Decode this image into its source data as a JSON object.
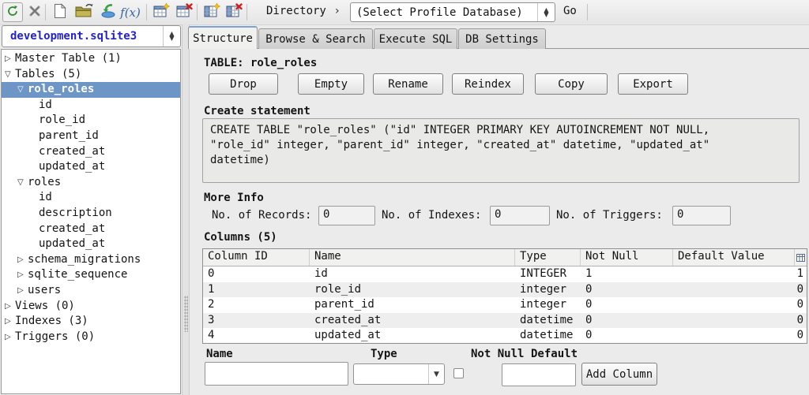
{
  "toolbar": {
    "directory_label": "Directory",
    "directory_chevron": "›",
    "profile_combo_value": "(Select Profile Database)",
    "go_label": "Go",
    "function_label": "f(x)",
    "icon_names": [
      "refresh-icon",
      "tools-icon",
      "new-file-icon",
      "open-folder-icon",
      "import-database-icon",
      "function-icon",
      "create-table-icon",
      "drop-table-icon",
      "add-column-icon",
      "drop-column-icon"
    ]
  },
  "sidebar": {
    "database_combo_value": "development.sqlite3",
    "tree": [
      {
        "label": "Master Table (1)",
        "exp": "▷"
      },
      {
        "label": "Tables (5)",
        "exp": "▽"
      },
      {
        "label": "role_roles",
        "exp": "▽"
      },
      {
        "label": "id",
        "exp": ""
      },
      {
        "label": "role_id",
        "exp": ""
      },
      {
        "label": "parent_id",
        "exp": ""
      },
      {
        "label": "created_at",
        "exp": ""
      },
      {
        "label": "updated_at",
        "exp": ""
      },
      {
        "label": "roles",
        "exp": "▽"
      },
      {
        "label": "id",
        "exp": ""
      },
      {
        "label": "description",
        "exp": ""
      },
      {
        "label": "created_at",
        "exp": ""
      },
      {
        "label": "updated_at",
        "exp": ""
      },
      {
        "label": "schema_migrations",
        "exp": "▷"
      },
      {
        "label": "sqlite_sequence",
        "exp": "▷"
      },
      {
        "label": "users",
        "exp": "▷"
      },
      {
        "label": "Views (0)",
        "exp": "▷"
      },
      {
        "label": "Indexes (3)",
        "exp": "▷"
      },
      {
        "label": "Triggers (0)",
        "exp": "▷"
      }
    ]
  },
  "tabs": [
    {
      "label": "Structure"
    },
    {
      "label": "Browse & Search"
    },
    {
      "label": "Execute SQL"
    },
    {
      "label": "DB Settings"
    }
  ],
  "structure": {
    "table_title": "TABLE: role_roles",
    "actions": [
      {
        "label": "Drop"
      },
      {
        "label": "Empty"
      },
      {
        "label": "Rename"
      },
      {
        "label": "Reindex"
      },
      {
        "label": "Copy"
      },
      {
        "label": "Export"
      }
    ],
    "create_statement_label": "Create statement",
    "create_statement_sql": "CREATE TABLE \"role_roles\" (\"id\" INTEGER PRIMARY KEY AUTOINCREMENT NOT NULL,\n\"role_id\" integer, \"parent_id\" integer, \"created_at\" datetime, \"updated_at\"\ndatetime)",
    "more_info_label": "More Info",
    "records_label": "No. of Records:",
    "records_value": "0",
    "indexes_label": "No. of Indexes:",
    "indexes_value": "0",
    "triggers_label": "No. of Triggers:",
    "triggers_value": "0",
    "columns_label": "Columns (5)",
    "columns_table": {
      "headers": {
        "id": "Column ID",
        "name": "Name",
        "type": "Type",
        "notnull": "Not Null",
        "default": "Default Value"
      },
      "rows": [
        {
          "id": "0",
          "name": "id",
          "type": "INTEGER",
          "notnull": "1",
          "default": "",
          "pk": "1"
        },
        {
          "id": "1",
          "name": "role_id",
          "type": "integer",
          "notnull": "0",
          "default": "",
          "pk": "0"
        },
        {
          "id": "2",
          "name": "parent_id",
          "type": "integer",
          "notnull": "0",
          "default": "",
          "pk": "0"
        },
        {
          "id": "3",
          "name": "created_at",
          "type": "datetime",
          "notnull": "0",
          "default": "",
          "pk": "0"
        },
        {
          "id": "4",
          "name": "updated_at",
          "type": "datetime",
          "notnull": "0",
          "default": "",
          "pk": "0"
        }
      ]
    },
    "add_column_form": {
      "name_label": "Name",
      "type_label": "Type",
      "notnull_label": "Not Null",
      "default_label": "Default",
      "name_value": "",
      "type_value": "",
      "default_value": "",
      "add_button_label": "Add Column"
    }
  },
  "colors": {
    "selection_blue": "#6d95c5",
    "database_name_text": "#2323cc",
    "active_tab_stripe": "#7ba1d7"
  }
}
